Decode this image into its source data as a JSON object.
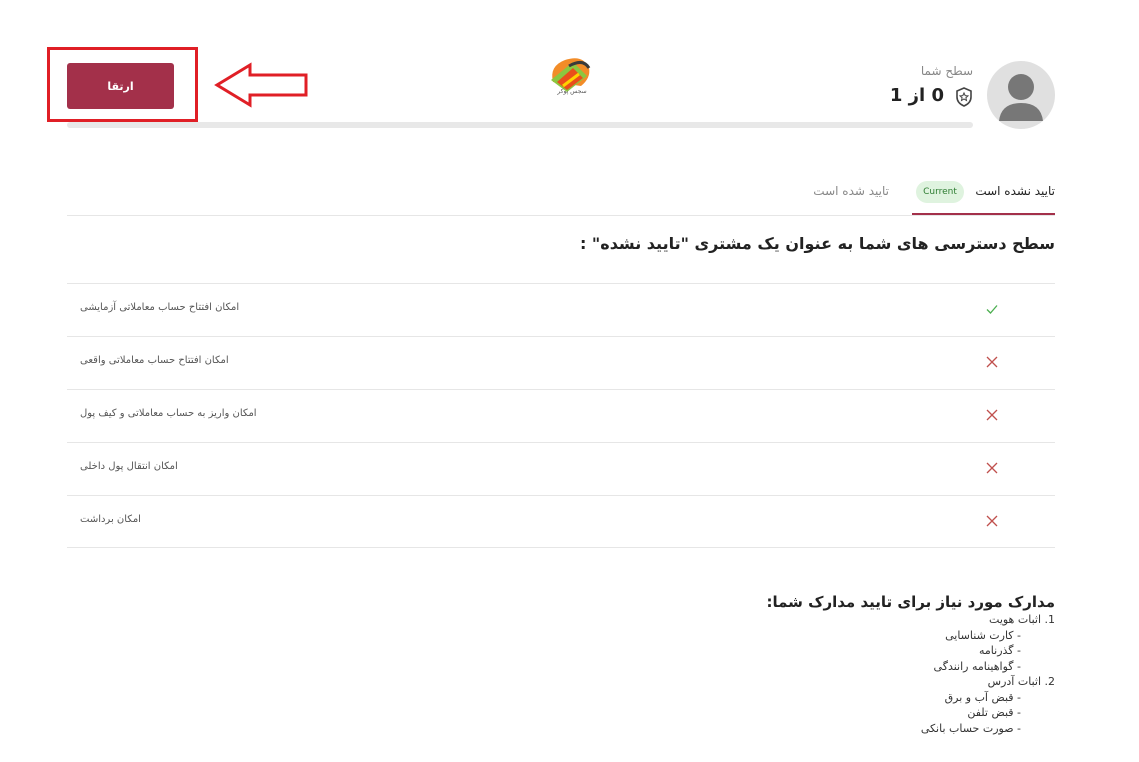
{
  "header": {
    "upgrade_label": "ارتقا",
    "logo_text": "سجس پوکر",
    "level_label": "سطح شما",
    "level_value": "0 از 1"
  },
  "tabs": {
    "active_label": "تایید نشده است",
    "current_badge": "Current",
    "next_label": "تایید شده است"
  },
  "section_title": "سطح دسترسی های شما به عنوان یک مشتری \"تایید نشده\" :",
  "access_items": [
    {
      "label": "امکان افتتاح حساب معاملاتی آزمایشی",
      "status": "check-icon",
      "allowed": true
    },
    {
      "label": "امکان افتتاح حساب معاملاتی واقعی",
      "status": "x-icon",
      "allowed": false
    },
    {
      "label": "امکان واریز به حساب معاملاتی و کیف پول",
      "status": "x-icon",
      "allowed": false
    },
    {
      "label": "امکان انتقال پول داخلی",
      "status": "x-icon",
      "allowed": false
    },
    {
      "label": "امکان برداشت",
      "status": "x-icon",
      "allowed": false
    }
  ],
  "documents": {
    "title": "مدارک مورد نیاز برای تایید مدارک شما:",
    "groups": [
      {
        "heading": "1. اثبات هویت",
        "items": [
          "- کارت شناسایی",
          "- گذرنامه",
          "- گواهینامه رانندگی"
        ]
      },
      {
        "heading": "2. اثبات آدرس",
        "items": [
          "- قبض آب و برق",
          "- قبض تلفن",
          "- صورت حساب بانکی"
        ]
      }
    ]
  },
  "colors": {
    "accent": "#a3304a",
    "highlight": "#e01f26",
    "check": "#4caf50",
    "cross": "#c0504d",
    "badge_bg": "#dff3df"
  }
}
